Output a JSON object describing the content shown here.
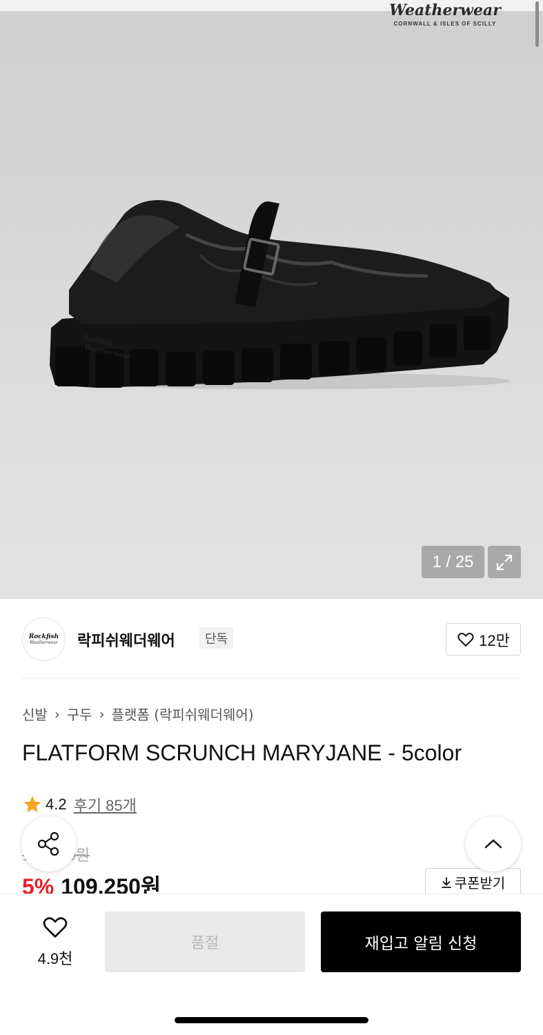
{
  "gallery": {
    "watermark_script": "Weatherwear",
    "watermark_sub": "CORNWALL & ISLES OF SCILLY",
    "sole_text_1": "Rockfish",
    "sole_text_2": "Weatherwear",
    "counter": "1 / 25"
  },
  "brand": {
    "logo_line1": "Rockfish",
    "logo_line2": "Weatherwear",
    "name": "락피쉬웨더웨어",
    "badge": "단독",
    "likes": "12만"
  },
  "breadcrumb": [
    "신발",
    "구두",
    "플랫폼 (락피쉬웨더웨어)"
  ],
  "product": {
    "title": "FLATFORM SCRUNCH MARYJANE - 5color",
    "rating": "4.2",
    "reviews": "후기 85개",
    "original_price": "115,000원",
    "discount": "5%",
    "final_price": "109,250원",
    "coupon_label": "쿠폰받기"
  },
  "bottom_bar": {
    "wish_count": "4.9천",
    "soldout_label": "품절",
    "restock_label": "재입고 알림 신청"
  },
  "colors": {
    "discount_red": "#e8212a",
    "star": "#f5a623",
    "primary_black": "#000000"
  }
}
